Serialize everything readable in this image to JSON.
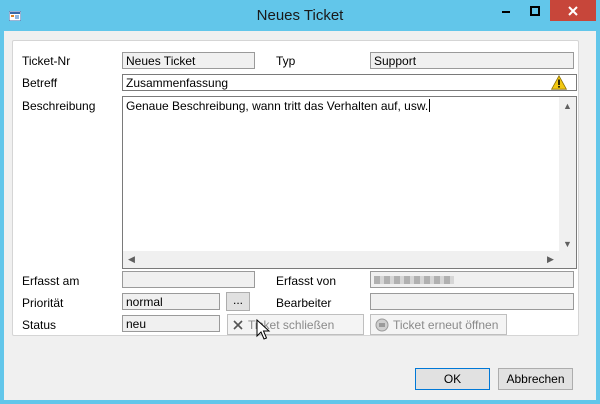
{
  "window": {
    "title": "Neues Ticket",
    "controls": {
      "minimize": "minimize",
      "maximize": "maximize",
      "close": "close"
    }
  },
  "form": {
    "ticket_nr": {
      "label": "Ticket-Nr",
      "value": "Neues Ticket"
    },
    "typ": {
      "label": "Typ",
      "value": "Support"
    },
    "betreff": {
      "label": "Betreff",
      "value": "Zusammenfassung",
      "status_icon": "warning-icon"
    },
    "beschreibung": {
      "label": "Beschreibung",
      "value": "Genaue Beschreibung, wann tritt das Verhalten auf, usw."
    },
    "erfasst_am": {
      "label": "Erfasst am",
      "value": ""
    },
    "erfasst_von": {
      "label": "Erfasst von",
      "value": ""
    },
    "prioritaet": {
      "label": "Priorität",
      "value": "normal",
      "browse_label": "..."
    },
    "bearbeiter": {
      "label": "Bearbeiter",
      "value": ""
    },
    "status": {
      "label": "Status",
      "value": "neu"
    }
  },
  "actions": {
    "close_ticket": "Ticket schließen",
    "reopen_ticket": "Ticket erneut öffnen"
  },
  "buttons": {
    "ok": "OK",
    "cancel": "Abbrechen"
  },
  "colors": {
    "titlebar": "#62c6ea",
    "close_button": "#c7463a",
    "warning": "#f2c811"
  }
}
